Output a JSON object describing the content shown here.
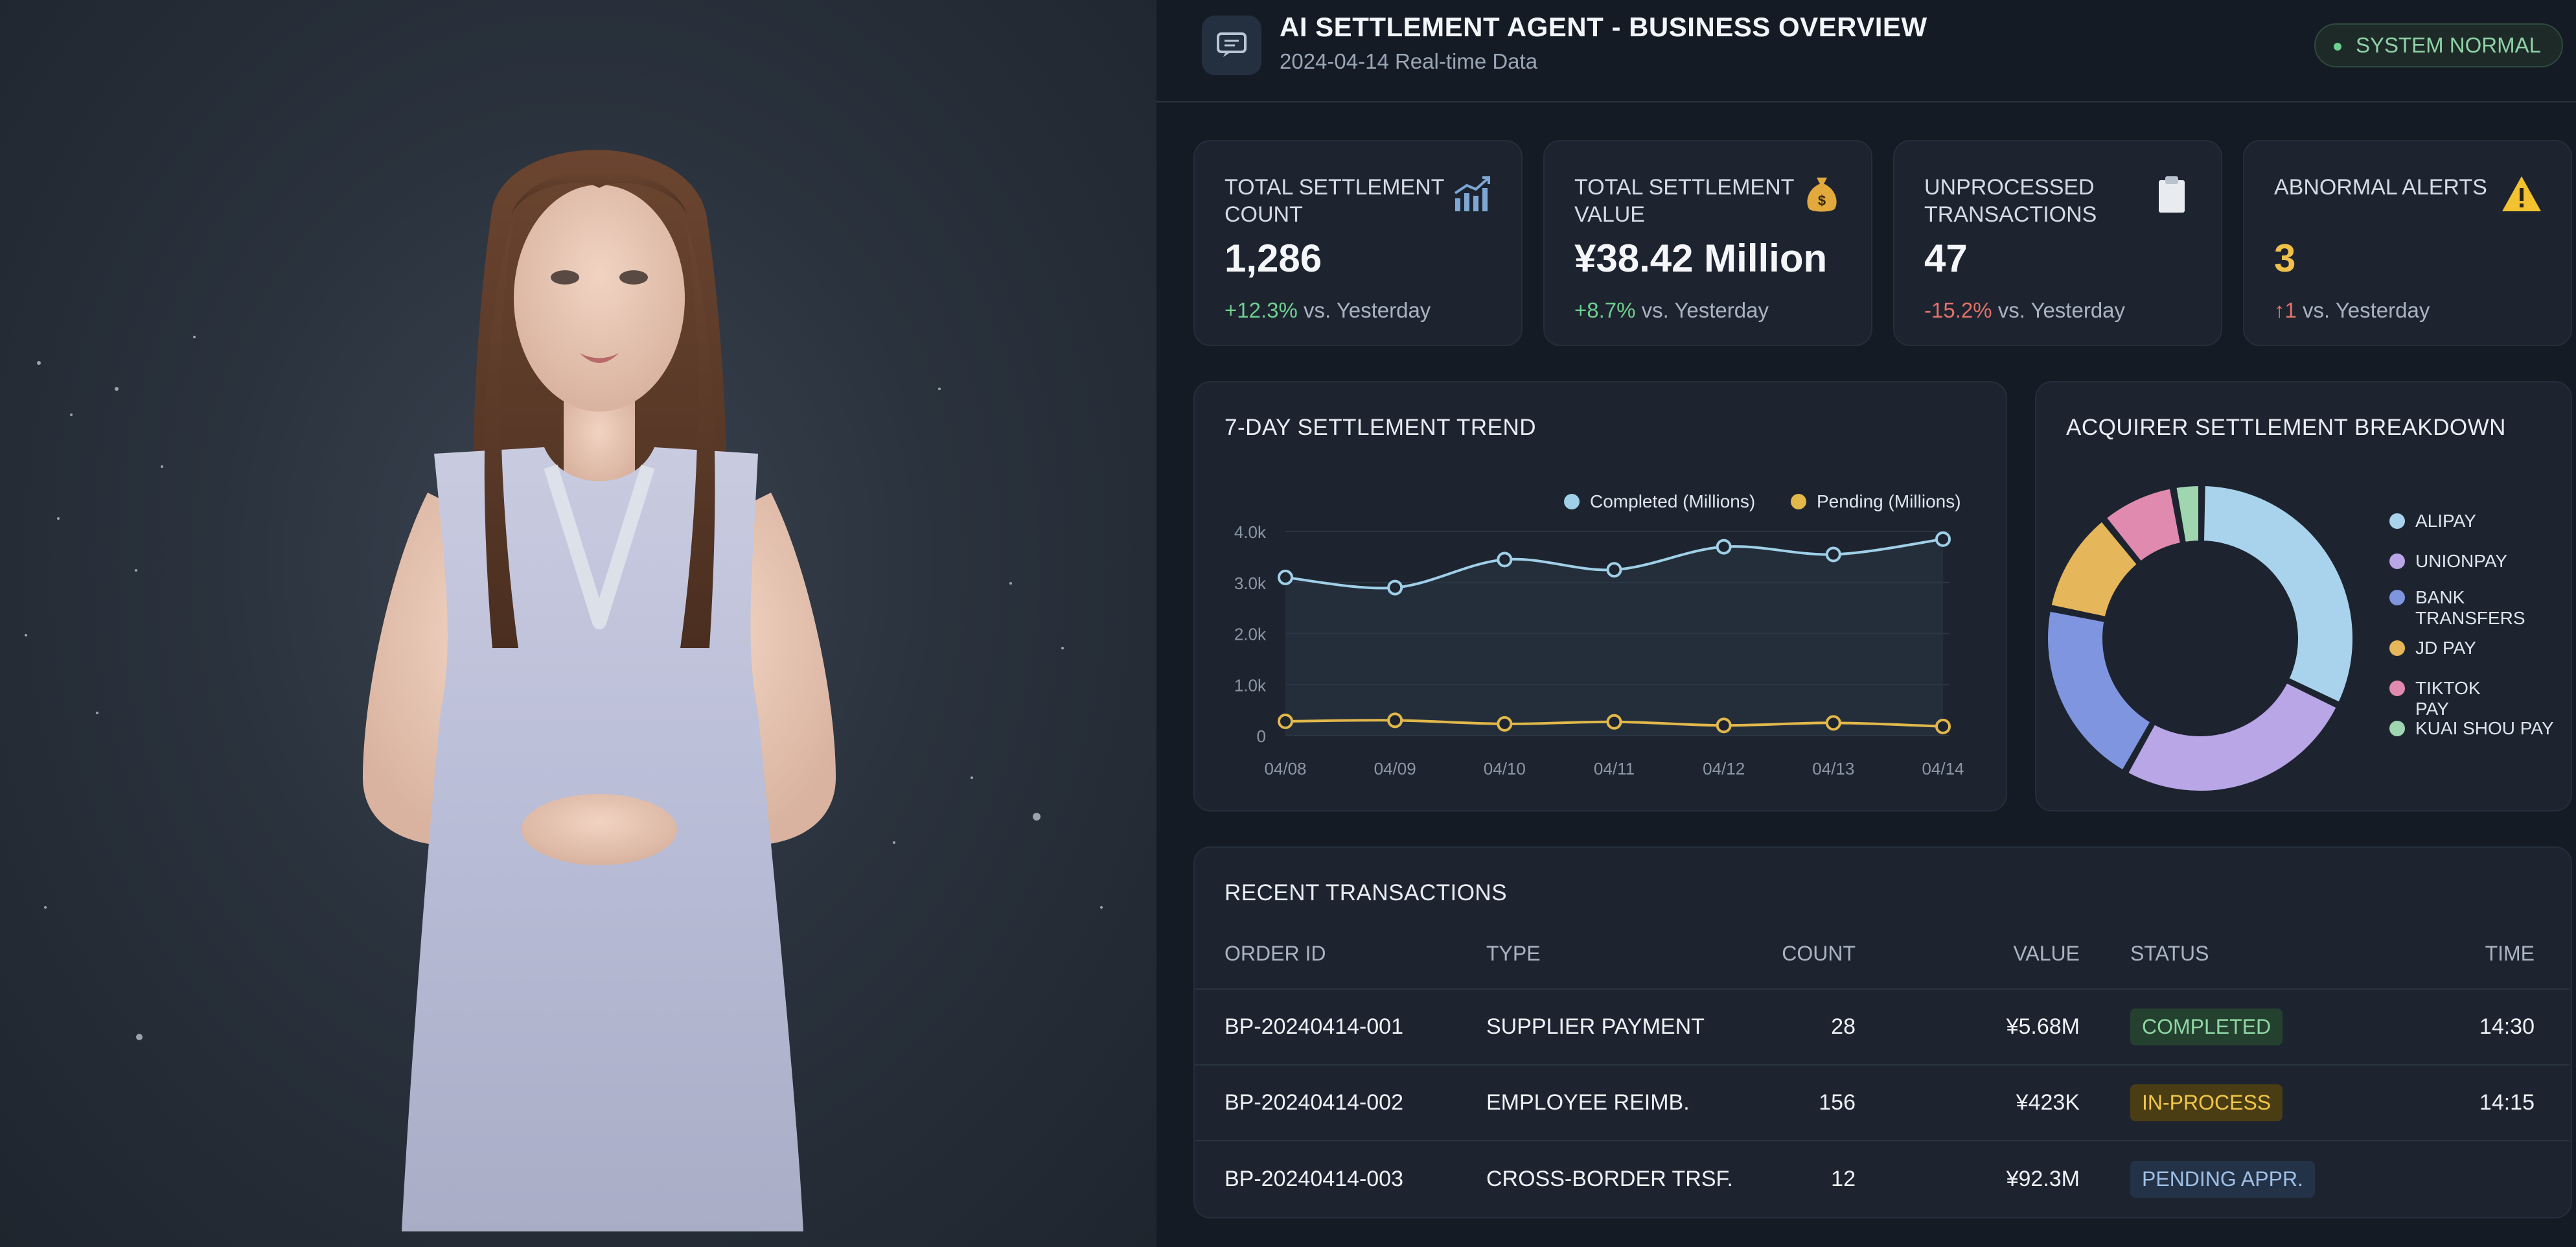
{
  "header": {
    "title": "AI SETTLEMENT AGENT - BUSINESS OVERVIEW",
    "subtitle": "2024-04-14 Real-time Data",
    "status": "SYSTEM NORMAL"
  },
  "kpis": [
    {
      "label": "TOTAL SETTLEMENT COUNT",
      "value": "1,286",
      "delta": "+12.3%",
      "delta_suffix": " vs. Yesterday",
      "trend": "up",
      "icon": "bar-chart-icon"
    },
    {
      "label": "TOTAL SETTLEMENT VALUE",
      "value": "¥38.42 Million",
      "delta": "+8.7%",
      "delta_suffix": " vs. Yesterday",
      "trend": "up",
      "icon": "money-bag-icon"
    },
    {
      "label": "UNPROCESSED TRANSACTIONS",
      "value": "47",
      "delta": "-15.2%",
      "delta_suffix": " vs. Yesterday",
      "trend": "down",
      "icon": "clipboard-icon"
    },
    {
      "label": "ABNORMAL ALERTS",
      "value": "3",
      "delta": "↑1",
      "delta_suffix": " vs. Yesterday",
      "trend": "down",
      "icon": "warning-icon"
    }
  ],
  "trend_chart": {
    "title": "7-DAY SETTLEMENT TREND",
    "chart_data": {
      "type": "line",
      "x": [
        "04/08",
        "04/09",
        "04/10",
        "04/11",
        "04/12",
        "04/13",
        "04/14"
      ],
      "series": [
        {
          "name": "Completed (Millions)",
          "color": "#9fd0e8",
          "values": [
            3100,
            2900,
            3450,
            3250,
            3700,
            3550,
            3850
          ]
        },
        {
          "name": "Pending (Millions)",
          "color": "#e2b84a",
          "values": [
            280,
            300,
            230,
            270,
            200,
            250,
            180
          ]
        }
      ],
      "yticks": [
        "4.0k",
        "3.0k",
        "2.0k",
        "1.0k",
        "0"
      ],
      "ylim": [
        0,
        4000
      ]
    }
  },
  "breakdown_chart": {
    "title": "ACQUIRER SETTLEMENT BREAKDOWN",
    "chart_data": {
      "type": "pie",
      "labels": [
        "ALIPAY",
        "UNIONPAY",
        "BANK TRANSFERS",
        "JD PAY",
        "TIKTOK PAY",
        "KUAI SHOU PAY"
      ],
      "values": [
        32,
        26,
        20,
        11,
        8,
        3
      ],
      "colors": [
        "#a9d3ec",
        "#b9a6e6",
        "#7f95e0",
        "#e6b65a",
        "#e08ab0",
        "#9fd6b0"
      ]
    }
  },
  "transactions": {
    "title": "RECENT TRANSACTIONS",
    "columns": [
      "ORDER ID",
      "TYPE",
      "COUNT",
      "VALUE",
      "STATUS",
      "TIME"
    ],
    "rows": [
      {
        "order_id": "BP-20240414-001",
        "type": "SUPPLIER PAYMENT",
        "count": "28",
        "value": "¥5.68M",
        "status": "COMPLETED",
        "status_kind": "completed",
        "time": "14:30"
      },
      {
        "order_id": "BP-20240414-002",
        "type": "EMPLOYEE REIMB.",
        "count": "156",
        "value": "¥423K",
        "status": "IN-PROCESS",
        "status_kind": "inprocess",
        "time": "14:15"
      },
      {
        "order_id": "BP-20240414-003",
        "type": "CROSS-BORDER TRSF.",
        "count": "12",
        "value": "¥92.3M",
        "status": "PENDING APPR.",
        "status_kind": "pending",
        "time": ""
      }
    ]
  }
}
